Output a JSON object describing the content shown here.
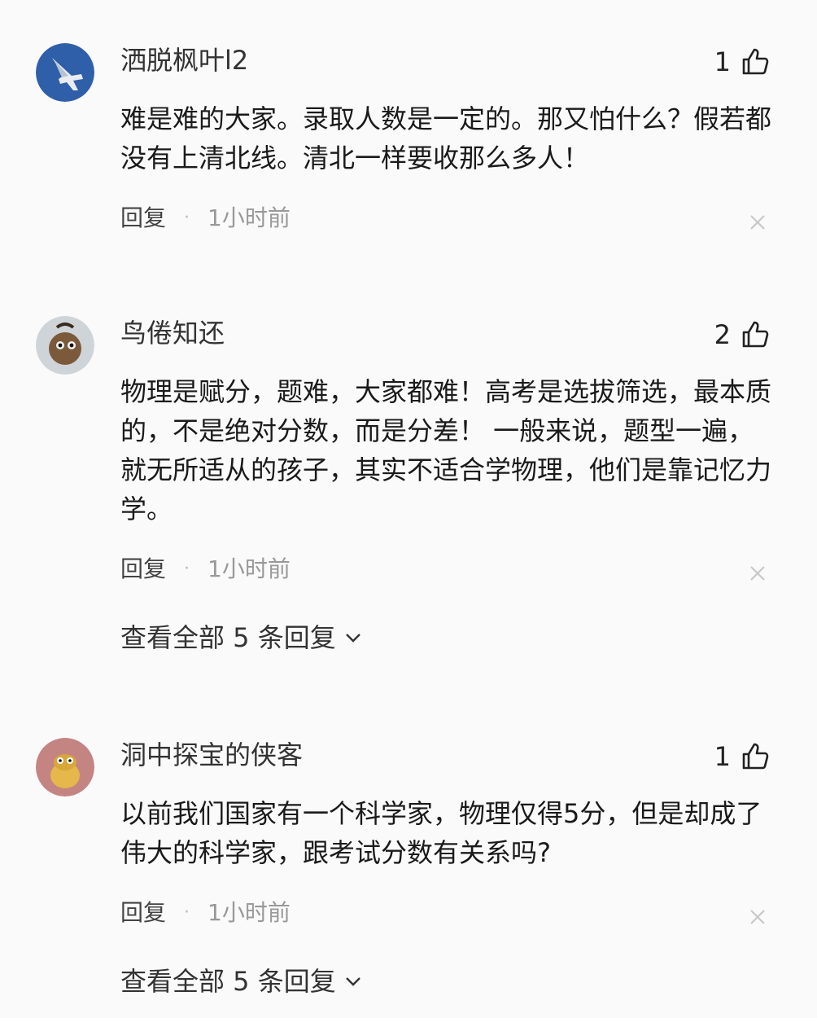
{
  "colors": {
    "background": "#fafafa",
    "text": "#1a1a1a",
    "meta": "#999999"
  },
  "comments": [
    {
      "username": "洒脱枫叶l2",
      "avatar_icon": "fighter-jet-avatar",
      "likes": "1",
      "text": "难是难的大家。录取人数是一定的。那又怕什么？假若都没有上清北线。清北一样要收那么多人！",
      "reply_label": "回复",
      "separator": "·",
      "time": "1小时前"
    },
    {
      "username": "鸟倦知还",
      "avatar_icon": "cartoon-avatar",
      "likes": "2",
      "text": "物理是赋分，题难，大家都难！高考是选拔筛选，最本质的，不是绝对分数，而是分差！ 一般来说，题型一遍，就无所适从的孩子，其实不适合学物理，他们是靠记忆力学。",
      "reply_label": "回复",
      "separator": "·",
      "time": "1小时前",
      "view_all": "查看全部 5 条回复"
    },
    {
      "username": "洞中探宝的侠客",
      "avatar_icon": "cartoon-creature-avatar",
      "likes": "1",
      "text": "以前我们国家有一个科学家，物理仅得5分，但是却成了伟大的科学家，跟考试分数有关系吗?",
      "reply_label": "回复",
      "separator": "·",
      "time": "1小时前",
      "view_all": "查看全部 5 条回复"
    }
  ]
}
